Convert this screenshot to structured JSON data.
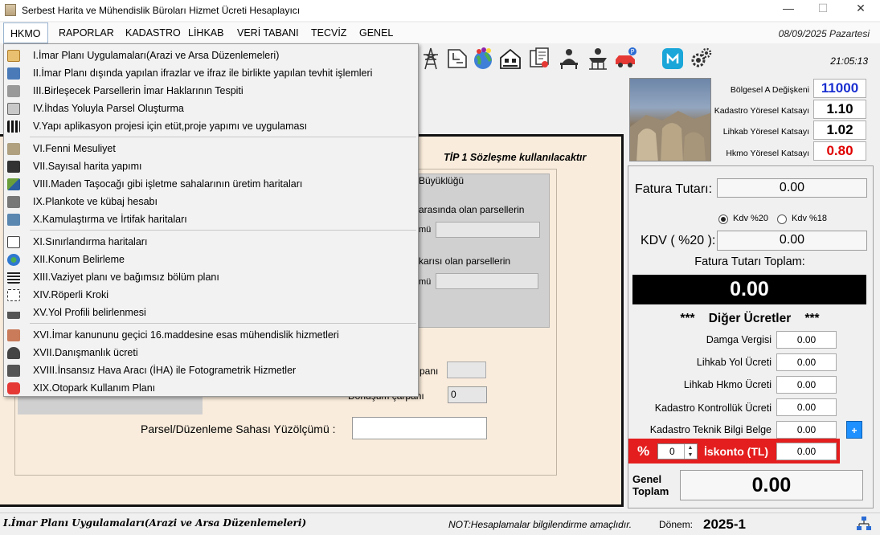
{
  "window": {
    "title": "Serbest Harita ve Mühendislik Büroları Hizmet Ücreti Hesaplayıcı",
    "minimize": "—",
    "maximize": "☐",
    "close": "✕"
  },
  "menu": {
    "items": [
      "HKMO",
      "RAPORLAR",
      "KADASTRO",
      "LİHKAB",
      "VERİ TABANI",
      "TECVİZ",
      "GENEL"
    ],
    "date": "08/09/2025 Pazartesi",
    "time": "21:05:13"
  },
  "dropdown": {
    "items": [
      "I.İmar Planı Uygulamaları(Arazi ve Arsa Düzenlemeleri)",
      "II.İmar Planı dışında yapılan ifrazlar ve ifraz ile birlikte yapılan tevhit işlemleri",
      "III.Birleşecek Parsellerin İmar Haklarının Tespiti",
      "IV.İhdas Yoluyla Parsel Oluşturma",
      "V.Yapı aplikasyon projesi için etüt,proje yapımı ve uygulaması",
      "VI.Fenni Mesuliyet",
      "VII.Sayısal harita yapımı",
      "VIII.Maden Taşocağı gibi işletme sahalarının üretim haritaları",
      "IX.Plankote ve kübaj hesabı",
      "X.Kamulaştırma ve İrtifak haritaları",
      "XI.Sınırlandırma haritaları",
      "XII.Konum Belirleme",
      "XIII.Vaziyet planı ve bağımsız bölüm planı",
      "XIV.Röperli Kroki",
      "XV.Yol Profili belirlenmesi",
      "XVI.İmar kanununu geçici 16.maddesine esas mühendislik hizmetleri",
      "XVII.Danışmanlık ücreti",
      "XVIII.İnsansız Hava Aracı (İHA) ile Fotogrametrik Hizmetler",
      "XIX.Otopark Kullanım Planı"
    ],
    "icons": [
      "map-plan-icon",
      "building-icon",
      "parcel-merge-icon",
      "parcel-create-icon",
      "qr-project-icon",
      "engineer-icon",
      "digital-map-icon",
      "mining-icon",
      "elevation-icon",
      "expropriation-icon",
      "boundary-icon",
      "globe-location-icon",
      "site-plan-icon",
      "sketch-icon",
      "road-profile-icon",
      "handshake-icon",
      "consultant-icon",
      "drone-icon",
      "parking-icon"
    ]
  },
  "main": {
    "contract_note": "TİP 1 Sözleşme kullanılacaktır",
    "group_title": "Büyüklüğü",
    "line1": "arasında olan parsellerin",
    "line1_suffix": "mü",
    "line2": "karısı olan parsellerin",
    "line2_suffix": "mü",
    "label_carpani": "panı",
    "label_donusum": "Dönüşüm çarpanı",
    "donusum_value": "0",
    "yuzolcumu_label": "Parsel/Düzenleme Sahası Yüzölçümü :"
  },
  "info": {
    "rows": [
      {
        "label": "Bölgesel A Değişkeni",
        "value": "11000",
        "color": "#1a2fd0"
      },
      {
        "label": "Kadastro Yöresel Katsayı",
        "value": "1.10",
        "color": "#000000"
      },
      {
        "label": "Lihkab Yöresel Katsayı",
        "value": "1.02",
        "color": "#000000"
      },
      {
        "label": "Hkmo Yöresel Katsayı",
        "value": "0.80",
        "color": "#e00000"
      }
    ]
  },
  "panel": {
    "fatura_label": "Fatura Tutarı:",
    "fatura_value": "0.00",
    "kdv20_label": "Kdv %20",
    "kdv18_label": "Kdv %18",
    "kdv_label": "KDV ( %20 ):",
    "kdv_value": "0.00",
    "toplam_label": "Fatura Tutarı Toplam:",
    "toplam_value": "0.00",
    "diger_title": "***    Diğer Ücretler    ***",
    "others": [
      {
        "label": "Damga Vergisi",
        "value": "0.00"
      },
      {
        "label": "Lihkab Yol Ücreti",
        "value": "0.00"
      },
      {
        "label": "Lihkab Hkmo Ücreti",
        "value": "0.00"
      },
      {
        "label": "Kadastro Kontrollük Ücreti",
        "value": "0.00"
      },
      {
        "label": "Kadastro Teknik Bilgi Belge",
        "value": "0.00"
      }
    ],
    "plus": "+",
    "percent_sign": "%",
    "percent_value": "0",
    "iskonto_label": "İskonto (TL)",
    "iskonto_value": "0.00",
    "genel_label_1": "Genel",
    "genel_label_2": "Toplam",
    "genel_value": "0.00"
  },
  "status": {
    "left": "I.İmar Planı Uygulamaları(Arazi ve Arsa Düzenlemeleri)",
    "note": "NOT:Hesaplamalar bilgilendirme amaçlıdır.",
    "donem_label": "Dönem:",
    "donem_value": "2025-1"
  },
  "toolbar": {
    "icons": [
      "power-tower-icon",
      "map-sheet-icon",
      "globe-pins-icon",
      "house-office-icon",
      "documents-icon",
      "meeting-icon",
      "survey-icon",
      "parking-car-icon",
      "app-icon",
      "settings-gears-icon"
    ]
  }
}
